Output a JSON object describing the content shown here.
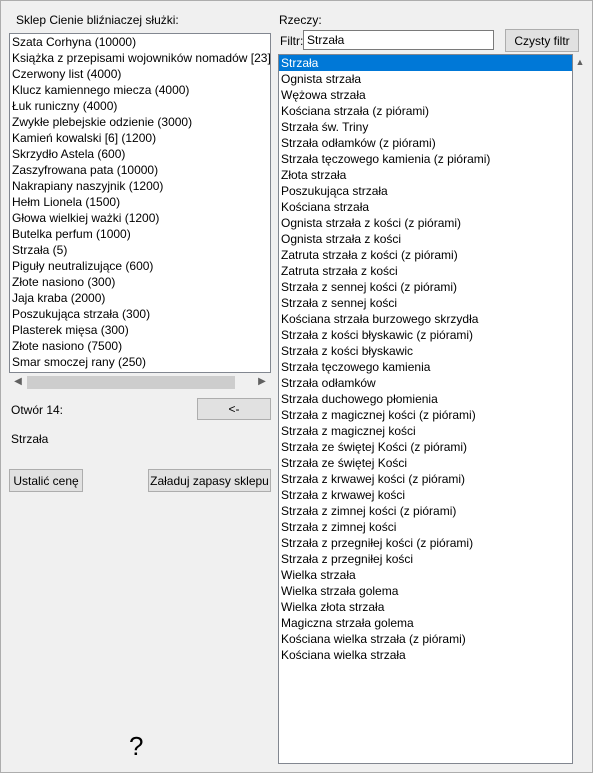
{
  "shop": {
    "title": "Sklep Cienie bliźniaczej służki:",
    "items": [
      "Szata Corhyna (10000)",
      "Książka z przepisami wojowników nomadów [23]",
      "Czerwony list (4000)",
      "Klucz kamiennego miecza (4000)",
      "Łuk runiczny (4000)",
      "Zwykłe plebejskie odzienie (3000)",
      "Kamień kowalski [6] (1200)",
      "Skrzydło Astela (600)",
      "Zaszyfrowana pata (10000)",
      "Nakrapiany naszyjnik (1200)",
      "Hełm Lionela (1500)",
      "Głowa wielkiej ważki (1200)",
      "Butelka perfum (1000)",
      "Strzała (5)",
      "Piguły neutralizujące (600)",
      "Złote nasiono (300)",
      "Jaja kraba (2000)",
      "Poszukująca strzała (300)",
      "Plasterek mięsa (300)",
      "Złote nasiono (7500)",
      "Smar smoczej rany (250)"
    ]
  },
  "slot": {
    "label": "Otwór 14:",
    "arrow_button": "<-",
    "value": "Strzała"
  },
  "actions": {
    "set_price": "Ustalić cenę",
    "load_stock": "Załaduj zapasy sklepu"
  },
  "help": {
    "symbol": "?"
  },
  "items_panel": {
    "title": "Rzeczy:",
    "filter_label": "Filtr:",
    "filter_value": "Strzała",
    "clear_button": "Czysty filtr",
    "selected_index": 0,
    "items": [
      "Strzała",
      "Ognista strzała",
      "Wężowa strzała",
      "Kościana strzała (z piórami)",
      "Strzała św. Triny",
      "Strzała odłamków (z piórami)",
      "Strzała tęczowego kamienia (z piórami)",
      "Złota strzała",
      "Poszukująca strzała",
      "Kościana strzała",
      "Ognista strzała z kości (z piórami)",
      "Ognista strzała z kości",
      "Zatruta strzała z kości (z piórami)",
      "Zatruta strzała z kości",
      "Strzała z sennej kości (z piórami)",
      "Strzała z sennej kości",
      "Kościana strzała burzowego skrzydła",
      "Strzała z kości błyskawic (z piórami)",
      "Strzała z kości błyskawic",
      "Strzała tęczowego kamienia",
      "Strzała odłamków",
      "Strzała duchowego płomienia",
      "Strzała z magicznej kości (z piórami)",
      "Strzała z magicznej kości",
      "Strzała ze świętej Kości (z piórami)",
      "Strzała ze świętej Kości",
      "Strzała z krwawej kości (z piórami)",
      "Strzała z krwawej kości",
      "Strzała z zimnej kości (z piórami)",
      "Strzała z zimnej kości",
      "Strzała z przegniłej kości (z piórami)",
      "Strzała z przegniłej kości",
      "Wielka strzała",
      "Wielka strzała golema",
      "Wielka złota strzała",
      "Magiczna strzała golema",
      "Kościana wielka strzała (z piórami)",
      "Kościana wielka strzała"
    ]
  }
}
